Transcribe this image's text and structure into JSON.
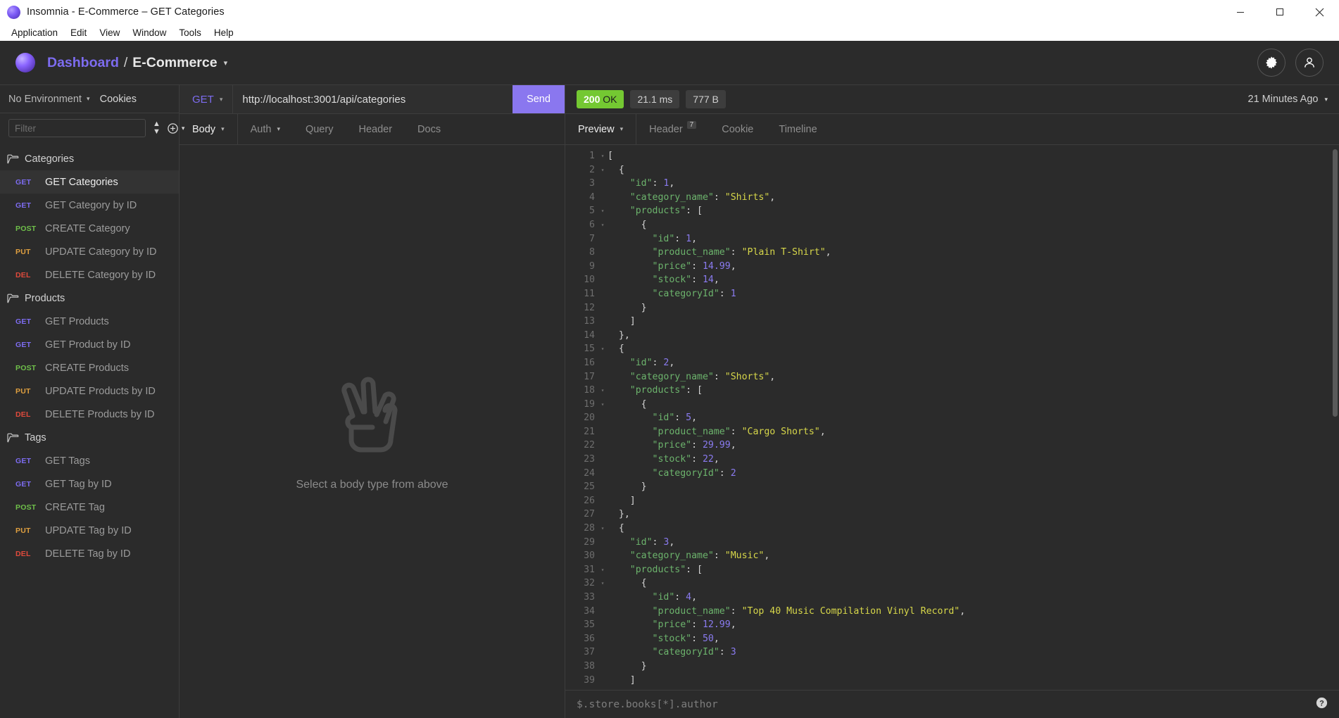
{
  "window": {
    "title": "Insomnia - E-Commerce – GET Categories",
    "logo_icon": "insomnia-logo-icon",
    "minimize_label": "—",
    "maximize_label": "□",
    "close_label": "✕"
  },
  "menubar": {
    "items": [
      {
        "label": "Application",
        "name": "menu-application"
      },
      {
        "label": "Edit",
        "name": "menu-edit"
      },
      {
        "label": "View",
        "name": "menu-view"
      },
      {
        "label": "Window",
        "name": "menu-window"
      },
      {
        "label": "Tools",
        "name": "menu-tools"
      },
      {
        "label": "Help",
        "name": "menu-help"
      }
    ]
  },
  "header": {
    "breadcrumb": {
      "dashboard": "Dashboard",
      "separator": "/",
      "project": "E-Commerce",
      "caret": "▾"
    },
    "settings_icon": "gear-icon",
    "account_icon": "user-avatar-icon"
  },
  "sidebar": {
    "environment": {
      "label": "No Environment",
      "caret": "▾"
    },
    "cookies_label": "Cookies",
    "filter": {
      "placeholder": "Filter",
      "value": ""
    },
    "sort_icon": "sort-icon",
    "add_icon": "plus-circle-icon",
    "add_caret": "▾",
    "tree": [
      {
        "type": "folder",
        "label": "Categories",
        "name": "sidebar-folder-categories"
      },
      {
        "type": "request",
        "method": "GET",
        "method_color": "#7d6cf0",
        "label": "GET Categories",
        "active": true
      },
      {
        "type": "request",
        "method": "GET",
        "method_color": "#7d6cf0",
        "label": "GET Category by ID",
        "active": false
      },
      {
        "type": "request",
        "method": "POST",
        "method_color": "#6fc04a",
        "label": "CREATE Category",
        "active": false
      },
      {
        "type": "request",
        "method": "PUT",
        "method_color": "#e0a040",
        "label": "UPDATE Category by ID",
        "active": false
      },
      {
        "type": "request",
        "method": "DEL",
        "method_color": "#e04a3c",
        "label": "DELETE Category by ID",
        "active": false
      },
      {
        "type": "folder",
        "label": "Products",
        "name": "sidebar-folder-products"
      },
      {
        "type": "request",
        "method": "GET",
        "method_color": "#7d6cf0",
        "label": "GET Products",
        "active": false
      },
      {
        "type": "request",
        "method": "GET",
        "method_color": "#7d6cf0",
        "label": "GET Product by ID",
        "active": false
      },
      {
        "type": "request",
        "method": "POST",
        "method_color": "#6fc04a",
        "label": "CREATE Products",
        "active": false
      },
      {
        "type": "request",
        "method": "PUT",
        "method_color": "#e0a040",
        "label": "UPDATE Products by ID",
        "active": false
      },
      {
        "type": "request",
        "method": "DEL",
        "method_color": "#e04a3c",
        "label": "DELETE Products by ID",
        "active": false
      },
      {
        "type": "folder",
        "label": "Tags",
        "name": "sidebar-folder-tags"
      },
      {
        "type": "request",
        "method": "GET",
        "method_color": "#7d6cf0",
        "label": "GET Tags",
        "active": false
      },
      {
        "type": "request",
        "method": "GET",
        "method_color": "#7d6cf0",
        "label": "GET Tag by ID",
        "active": false
      },
      {
        "type": "request",
        "method": "POST",
        "method_color": "#6fc04a",
        "label": "CREATE Tag",
        "active": false
      },
      {
        "type": "request",
        "method": "PUT",
        "method_color": "#e0a040",
        "label": "UPDATE Tag by ID",
        "active": false
      },
      {
        "type": "request",
        "method": "DEL",
        "method_color": "#e04a3c",
        "label": "DELETE Tag by ID",
        "active": false
      }
    ]
  },
  "request": {
    "method": "GET",
    "method_caret": "▾",
    "url": "http://localhost:3001/api/categories",
    "send_label": "Send",
    "tabs": [
      {
        "label": "Body",
        "caret": "▾",
        "selected": true
      },
      {
        "label": "Auth",
        "caret": "▾",
        "selected": false
      },
      {
        "label": "Query",
        "caret": "",
        "selected": false
      },
      {
        "label": "Header",
        "caret": "",
        "selected": false
      },
      {
        "label": "Docs",
        "caret": "",
        "selected": false
      }
    ],
    "empty_state": {
      "icon": "peace-hand-icon",
      "text": "Select a body type from above"
    }
  },
  "response": {
    "status_code": "200",
    "status_text": "OK",
    "time": "21.1 ms",
    "size": "777 B",
    "timestamp": "21 Minutes Ago",
    "timestamp_caret": "▾",
    "tabs": [
      {
        "label": "Preview",
        "caret": "▾",
        "badge": "",
        "selected": true
      },
      {
        "label": "Header",
        "caret": "",
        "badge": "7",
        "selected": false
      },
      {
        "label": "Cookie",
        "caret": "",
        "badge": "",
        "selected": false
      },
      {
        "label": "Timeline",
        "caret": "",
        "badge": "",
        "selected": false
      }
    ],
    "filter_placeholder": "$.store.books[*].author",
    "help_icon": "question-circle-icon",
    "body_lines": [
      {
        "n": 1,
        "fold": true,
        "tokens": [
          {
            "t": "p",
            "v": "["
          }
        ]
      },
      {
        "n": 2,
        "fold": true,
        "tokens": [
          {
            "t": "p",
            "v": "  {"
          }
        ]
      },
      {
        "n": 3,
        "fold": false,
        "tokens": [
          {
            "t": "k",
            "v": "    \"id\""
          },
          {
            "t": "p",
            "v": ": "
          },
          {
            "t": "n",
            "v": "1"
          },
          {
            "t": "p",
            "v": ","
          }
        ]
      },
      {
        "n": 4,
        "fold": false,
        "tokens": [
          {
            "t": "k",
            "v": "    \"category_name\""
          },
          {
            "t": "p",
            "v": ": "
          },
          {
            "t": "s",
            "v": "\"Shirts\""
          },
          {
            "t": "p",
            "v": ","
          }
        ]
      },
      {
        "n": 5,
        "fold": true,
        "tokens": [
          {
            "t": "k",
            "v": "    \"products\""
          },
          {
            "t": "p",
            "v": ": ["
          }
        ]
      },
      {
        "n": 6,
        "fold": true,
        "tokens": [
          {
            "t": "p",
            "v": "      {"
          }
        ]
      },
      {
        "n": 7,
        "fold": false,
        "tokens": [
          {
            "t": "k",
            "v": "        \"id\""
          },
          {
            "t": "p",
            "v": ": "
          },
          {
            "t": "n",
            "v": "1"
          },
          {
            "t": "p",
            "v": ","
          }
        ]
      },
      {
        "n": 8,
        "fold": false,
        "tokens": [
          {
            "t": "k",
            "v": "        \"product_name\""
          },
          {
            "t": "p",
            "v": ": "
          },
          {
            "t": "s",
            "v": "\"Plain T-Shirt\""
          },
          {
            "t": "p",
            "v": ","
          }
        ]
      },
      {
        "n": 9,
        "fold": false,
        "tokens": [
          {
            "t": "k",
            "v": "        \"price\""
          },
          {
            "t": "p",
            "v": ": "
          },
          {
            "t": "n",
            "v": "14.99"
          },
          {
            "t": "p",
            "v": ","
          }
        ]
      },
      {
        "n": 10,
        "fold": false,
        "tokens": [
          {
            "t": "k",
            "v": "        \"stock\""
          },
          {
            "t": "p",
            "v": ": "
          },
          {
            "t": "n",
            "v": "14"
          },
          {
            "t": "p",
            "v": ","
          }
        ]
      },
      {
        "n": 11,
        "fold": false,
        "tokens": [
          {
            "t": "k",
            "v": "        \"categoryId\""
          },
          {
            "t": "p",
            "v": ": "
          },
          {
            "t": "n",
            "v": "1"
          }
        ]
      },
      {
        "n": 12,
        "fold": false,
        "tokens": [
          {
            "t": "p",
            "v": "      }"
          }
        ]
      },
      {
        "n": 13,
        "fold": false,
        "tokens": [
          {
            "t": "p",
            "v": "    ]"
          }
        ]
      },
      {
        "n": 14,
        "fold": false,
        "tokens": [
          {
            "t": "p",
            "v": "  },"
          }
        ]
      },
      {
        "n": 15,
        "fold": true,
        "tokens": [
          {
            "t": "p",
            "v": "  {"
          }
        ]
      },
      {
        "n": 16,
        "fold": false,
        "tokens": [
          {
            "t": "k",
            "v": "    \"id\""
          },
          {
            "t": "p",
            "v": ": "
          },
          {
            "t": "n",
            "v": "2"
          },
          {
            "t": "p",
            "v": ","
          }
        ]
      },
      {
        "n": 17,
        "fold": false,
        "tokens": [
          {
            "t": "k",
            "v": "    \"category_name\""
          },
          {
            "t": "p",
            "v": ": "
          },
          {
            "t": "s",
            "v": "\"Shorts\""
          },
          {
            "t": "p",
            "v": ","
          }
        ]
      },
      {
        "n": 18,
        "fold": true,
        "tokens": [
          {
            "t": "k",
            "v": "    \"products\""
          },
          {
            "t": "p",
            "v": ": ["
          }
        ]
      },
      {
        "n": 19,
        "fold": true,
        "tokens": [
          {
            "t": "p",
            "v": "      {"
          }
        ]
      },
      {
        "n": 20,
        "fold": false,
        "tokens": [
          {
            "t": "k",
            "v": "        \"id\""
          },
          {
            "t": "p",
            "v": ": "
          },
          {
            "t": "n",
            "v": "5"
          },
          {
            "t": "p",
            "v": ","
          }
        ]
      },
      {
        "n": 21,
        "fold": false,
        "tokens": [
          {
            "t": "k",
            "v": "        \"product_name\""
          },
          {
            "t": "p",
            "v": ": "
          },
          {
            "t": "s",
            "v": "\"Cargo Shorts\""
          },
          {
            "t": "p",
            "v": ","
          }
        ]
      },
      {
        "n": 22,
        "fold": false,
        "tokens": [
          {
            "t": "k",
            "v": "        \"price\""
          },
          {
            "t": "p",
            "v": ": "
          },
          {
            "t": "n",
            "v": "29.99"
          },
          {
            "t": "p",
            "v": ","
          }
        ]
      },
      {
        "n": 23,
        "fold": false,
        "tokens": [
          {
            "t": "k",
            "v": "        \"stock\""
          },
          {
            "t": "p",
            "v": ": "
          },
          {
            "t": "n",
            "v": "22"
          },
          {
            "t": "p",
            "v": ","
          }
        ]
      },
      {
        "n": 24,
        "fold": false,
        "tokens": [
          {
            "t": "k",
            "v": "        \"categoryId\""
          },
          {
            "t": "p",
            "v": ": "
          },
          {
            "t": "n",
            "v": "2"
          }
        ]
      },
      {
        "n": 25,
        "fold": false,
        "tokens": [
          {
            "t": "p",
            "v": "      }"
          }
        ]
      },
      {
        "n": 26,
        "fold": false,
        "tokens": [
          {
            "t": "p",
            "v": "    ]"
          }
        ]
      },
      {
        "n": 27,
        "fold": false,
        "tokens": [
          {
            "t": "p",
            "v": "  },"
          }
        ]
      },
      {
        "n": 28,
        "fold": true,
        "tokens": [
          {
            "t": "p",
            "v": "  {"
          }
        ]
      },
      {
        "n": 29,
        "fold": false,
        "tokens": [
          {
            "t": "k",
            "v": "    \"id\""
          },
          {
            "t": "p",
            "v": ": "
          },
          {
            "t": "n",
            "v": "3"
          },
          {
            "t": "p",
            "v": ","
          }
        ]
      },
      {
        "n": 30,
        "fold": false,
        "tokens": [
          {
            "t": "k",
            "v": "    \"category_name\""
          },
          {
            "t": "p",
            "v": ": "
          },
          {
            "t": "s",
            "v": "\"Music\""
          },
          {
            "t": "p",
            "v": ","
          }
        ]
      },
      {
        "n": 31,
        "fold": true,
        "tokens": [
          {
            "t": "k",
            "v": "    \"products\""
          },
          {
            "t": "p",
            "v": ": ["
          }
        ]
      },
      {
        "n": 32,
        "fold": true,
        "tokens": [
          {
            "t": "p",
            "v": "      {"
          }
        ]
      },
      {
        "n": 33,
        "fold": false,
        "tokens": [
          {
            "t": "k",
            "v": "        \"id\""
          },
          {
            "t": "p",
            "v": ": "
          },
          {
            "t": "n",
            "v": "4"
          },
          {
            "t": "p",
            "v": ","
          }
        ]
      },
      {
        "n": 34,
        "fold": false,
        "tokens": [
          {
            "t": "k",
            "v": "        \"product_name\""
          },
          {
            "t": "p",
            "v": ": "
          },
          {
            "t": "s",
            "v": "\"Top 40 Music Compilation Vinyl Record\""
          },
          {
            "t": "p",
            "v": ","
          }
        ]
      },
      {
        "n": 35,
        "fold": false,
        "tokens": [
          {
            "t": "k",
            "v": "        \"price\""
          },
          {
            "t": "p",
            "v": ": "
          },
          {
            "t": "n",
            "v": "12.99"
          },
          {
            "t": "p",
            "v": ","
          }
        ]
      },
      {
        "n": 36,
        "fold": false,
        "tokens": [
          {
            "t": "k",
            "v": "        \"stock\""
          },
          {
            "t": "p",
            "v": ": "
          },
          {
            "t": "n",
            "v": "50"
          },
          {
            "t": "p",
            "v": ","
          }
        ]
      },
      {
        "n": 37,
        "fold": false,
        "tokens": [
          {
            "t": "k",
            "v": "        \"categoryId\""
          },
          {
            "t": "p",
            "v": ": "
          },
          {
            "t": "n",
            "v": "3"
          }
        ]
      },
      {
        "n": 38,
        "fold": false,
        "tokens": [
          {
            "t": "p",
            "v": "      }"
          }
        ]
      },
      {
        "n": 39,
        "fold": false,
        "tokens": [
          {
            "t": "p",
            "v": "    ]"
          }
        ]
      }
    ]
  }
}
